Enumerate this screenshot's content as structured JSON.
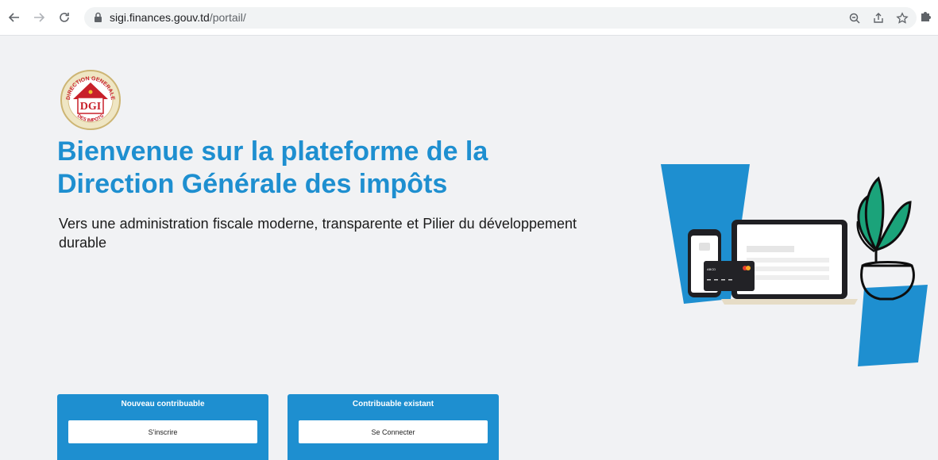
{
  "browser": {
    "url_host": "sigi.finances.gouv.td",
    "url_path": "/portail/"
  },
  "page": {
    "title_line1": "Bienvenue sur la plateforme de la",
    "title_line2": "Direction Générale des impôts",
    "subtitle": "Vers une administration fiscale moderne, transparente et Pilier du développement durable",
    "logo": {
      "top_text": "DIRECTION GENERALE",
      "center_text": "DGI",
      "bottom_text": "DES IMPOTS"
    }
  },
  "cards": [
    {
      "title": "Nouveau contribuable",
      "button": "S'inscrire"
    },
    {
      "title": "Contribuable existant",
      "button": "Se Connecter"
    }
  ],
  "colors": {
    "brand_blue": "#1e8fd0",
    "page_bg": "#f1f2f4",
    "logo_red": "#c8202a",
    "plant_green": "#1ba37a"
  }
}
